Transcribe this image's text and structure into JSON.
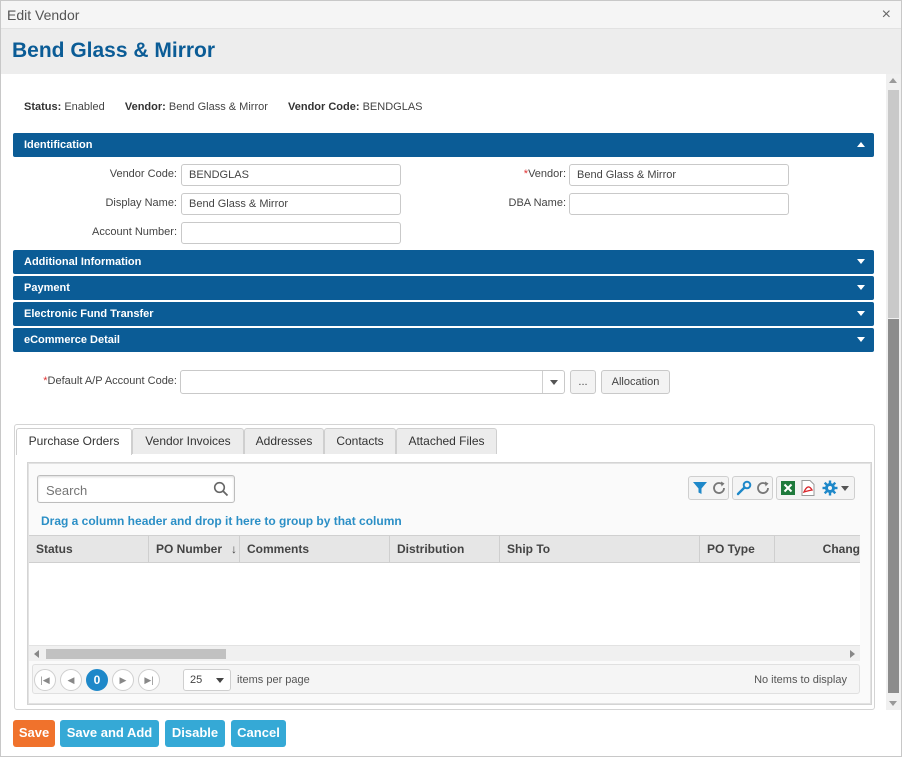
{
  "window": {
    "title": "Edit Vendor",
    "close_glyph": "×"
  },
  "header": {
    "vendor_name": "Bend Glass & Mirror"
  },
  "status_line": {
    "status_label": "Status:",
    "status_value": "Enabled",
    "vendor_label": "Vendor:",
    "vendor_value": "Bend Glass & Mirror",
    "code_label": "Vendor Code:",
    "code_value": "BENDGLAS"
  },
  "sections": {
    "identification": "Identification",
    "additional_information": "Additional Information",
    "payment": "Payment",
    "eft": "Electronic Fund Transfer",
    "ecommerce": "eCommerce Detail"
  },
  "identification": {
    "vendor_code_label": "Vendor Code:",
    "vendor_code_value": "BENDGLAS",
    "vendor_label": "Vendor:",
    "vendor_required": "*",
    "vendor_value": "Bend Glass & Mirror",
    "display_name_label": "Display Name:",
    "display_name_value": "Bend Glass & Mirror",
    "dba_name_label": "DBA Name:",
    "dba_name_value": "",
    "account_number_label": "Account Number:",
    "account_number_value": ""
  },
  "default_ap": {
    "required": "*",
    "label": "Default A/P Account Code:",
    "value": "",
    "ellipsis_label": "...",
    "allocation_label": "Allocation"
  },
  "tabs": [
    "Purchase Orders",
    "Vendor Invoices",
    "Addresses",
    "Contacts",
    "Attached Files"
  ],
  "grid": {
    "search_placeholder": "Search",
    "group_hint": "Drag a column header and drop it here to group by that column",
    "columns": [
      "Status",
      "PO Number",
      "Comments",
      "Distribution",
      "Ship To",
      "PO Type",
      "Chang"
    ],
    "sort_indicator": "↓",
    "toolbar_icons": [
      "filter-icon",
      "refresh-icon",
      "wrench-icon",
      "reset-icon",
      "excel-icon",
      "pdf-icon",
      "gear-icon",
      "caret-down-icon"
    ]
  },
  "pager": {
    "current_page": "0",
    "page_size": "25",
    "items_per_page": "items per page",
    "no_items": "No items to display"
  },
  "footer": {
    "save": "Save",
    "save_and_add": "Save and Add",
    "disable": "Disable",
    "cancel": "Cancel"
  },
  "colors": {
    "primary": "#0b5c96",
    "accent_blue": "#35a9d6",
    "save_orange": "#f0722c",
    "required_red": "#e03434"
  }
}
